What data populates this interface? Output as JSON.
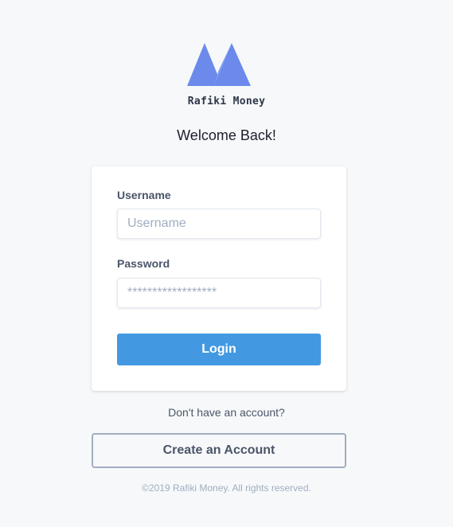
{
  "brand": {
    "name": "Rafiki Money",
    "logo_icon": "mountain-logo-icon",
    "logo_color": "#6b8aeb"
  },
  "welcome": "Welcome Back!",
  "login_form": {
    "username_label": "Username",
    "username_placeholder": "Username",
    "username_value": "",
    "password_label": "Password",
    "password_placeholder": "******************",
    "password_value": "",
    "login_label": "Login",
    "login_color": "#4299e1"
  },
  "signup": {
    "prompt": "Don't have an account?",
    "create_label": "Create an Account"
  },
  "footer": "©2019 Rafiki Money. All rights reserved."
}
